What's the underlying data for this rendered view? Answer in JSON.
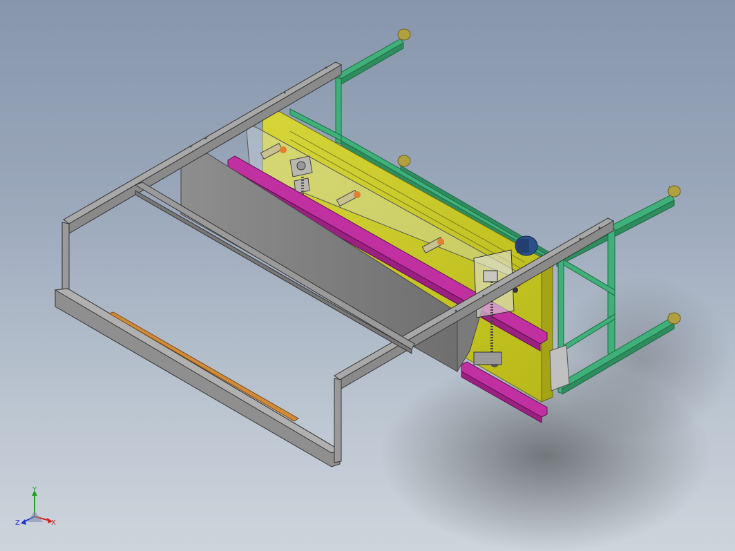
{
  "view": {
    "triad": {
      "x_label": "X",
      "y_label": "Y",
      "z_label": "Z",
      "x_color": "#d42020",
      "y_color": "#1ea01e",
      "z_color": "#2030c8"
    }
  },
  "model_colors": {
    "green_frame": "#3fb07a",
    "gray_frame": "#8c8c8c",
    "yellow_panel": "#c8c81e",
    "magenta_rail": "#c030a0",
    "orange_strip": "#d08a3a",
    "blue_motor": "#2a4f8a",
    "feet": "#b0a040"
  }
}
